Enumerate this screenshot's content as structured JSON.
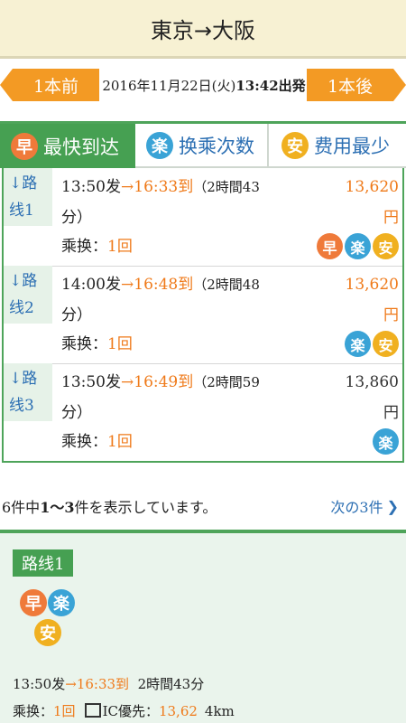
{
  "header": {
    "title": "東京→大阪"
  },
  "nav": {
    "prev_label": "1本前",
    "date_text": "2016年11月22日(火)",
    "time_text": "13:42出発",
    "next_label": "1本後"
  },
  "tabs": [
    {
      "icon_char": "早",
      "label": "最快到达"
    },
    {
      "icon_char": "楽",
      "label": "换乘次数"
    },
    {
      "icon_char": "安",
      "label": "费用最少"
    }
  ],
  "routes": [
    {
      "label": "↓路线1",
      "depart": "13:50发",
      "arrive": "16:33到",
      "duration": "（2時間43",
      "duration2": "分）",
      "fare": "13,620",
      "yen": "円",
      "transfer_label": "乘换：",
      "transfer_count": "1回",
      "badges": [
        "早",
        "楽",
        "安"
      ]
    },
    {
      "label": "↓路线2",
      "depart": "14:00发",
      "arrive": "16:48到",
      "duration": "（2時間48",
      "duration2": "分）",
      "fare": "13,620",
      "yen": "円",
      "transfer_label": "乘换：",
      "transfer_count": "1回",
      "badges": [
        "楽",
        "安"
      ]
    },
    {
      "label": "↓路线3",
      "depart": "13:50发",
      "arrive": "16:49到",
      "duration": "（2時間59",
      "duration2": "分）",
      "fare": "13,860",
      "yen": "円",
      "transfer_label": "乘换：",
      "transfer_count": "1回",
      "badges": [
        "楽"
      ]
    }
  ],
  "pager": {
    "count_prefix": "6件中",
    "range": "1～3",
    "count_suffix": "件を表示しています。",
    "next_label": "次の3件",
    "next_icon": "❯"
  },
  "detail": {
    "title": "路线1",
    "badges": [
      "早",
      "楽",
      "安"
    ],
    "depart": "13:50发",
    "arrive": "16:33到",
    "duration": "2時間43分",
    "transfer_label": "乘换：",
    "transfer_count": "1回",
    "ic_label": "IC優先：",
    "ic_fare": "13,62",
    "distance": "4km"
  },
  "colors": {
    "green": "#46a052",
    "orange": "#f39a24",
    "blue": "#2c6fb3",
    "fast": "#ef7a3a",
    "easy": "#3aa3d6",
    "cheap": "#f0b020"
  }
}
